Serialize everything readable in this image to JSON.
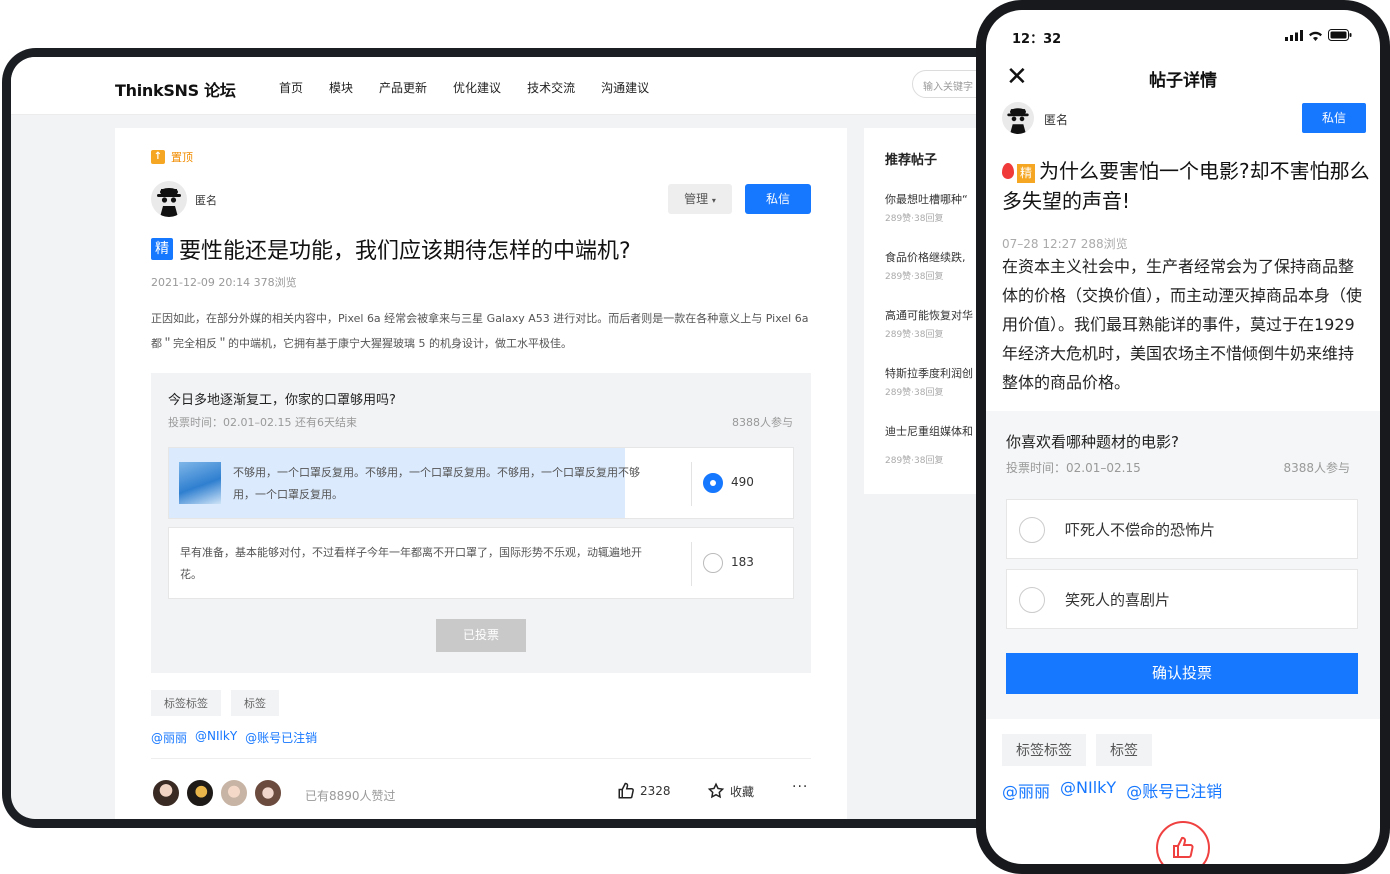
{
  "desktop": {
    "logo": {
      "brand": "ThinkSNS",
      "suffix": "论坛"
    },
    "nav": [
      "首页",
      "模块",
      "产品更新",
      "优化建议",
      "技术交流",
      "沟通建议"
    ],
    "search_placeholder": "输入关键字",
    "post": {
      "pinned_label": "置顶",
      "author": "匿名",
      "manage_label": "管理",
      "pm_label": "私信",
      "badge": "精",
      "title": "要性能还是功能，我们应该期待怎样的中端机?",
      "meta": "2021-12-09 20:14  378浏览",
      "body": "正因如此，在部分外媒的相关内容中，Pixel 6a 经常会被拿来与三星 Galaxy A53 进行对比。而后者则是一款在各种意义上与 Pixel 6a 都＂完全相反＂的中端机，它拥有基于康宁大猩猩玻璃 5 的机身设计，做工水平极佳。",
      "vote": {
        "question": "今日多地逐渐复工，你家的口罩够用吗?",
        "time": "投票时间：02.01–02.15    还有6天结束",
        "participants": "8388人参与",
        "options": [
          {
            "text": "不够用，一个口罩反复用。不够用，一个口罩反复用。不够用，一个口罩反复用不够用，一个口罩反复用。",
            "count": "490",
            "selected": true,
            "share": 0.73
          },
          {
            "text": "早有准备，基本能够对付，不过看样子今年一年都离不开口罩了，国际形势不乐观，动辄遍地开花。",
            "count": "183",
            "selected": false,
            "share": 0
          }
        ],
        "voted_label": "已投票"
      },
      "tags": [
        "标签标签",
        "标签"
      ],
      "mentions": [
        "@丽丽",
        "@NIlkY",
        "@账号已注销"
      ],
      "likers_text": "已有8890人赞过",
      "like_count": "2328",
      "fav_label": "收藏",
      "more_label": "···"
    },
    "recommend": {
      "title": "推荐帖子",
      "items": [
        {
          "title": "你最想吐槽哪种“",
          "meta": "289赞·38回复"
        },
        {
          "title": "食品价格继续跌,",
          "meta": "289赞·38回复"
        },
        {
          "title": "高通可能恢复对华",
          "meta": "289赞·38回复"
        },
        {
          "title": "特斯拉季度利润创",
          "meta": "289赞·38回复"
        },
        {
          "title": "迪士尼重组媒体和",
          "meta": "289赞·38回复"
        }
      ]
    }
  },
  "phone": {
    "status_time": "12：32",
    "header_title": "帖子详情",
    "author": "匿名",
    "pm_label": "私信",
    "badge": "精",
    "title": "为什么要害怕一个电影?却不害怕那么多失望的声音!",
    "meta": "07–28 12:27  288浏览",
    "body": "在资本主义社会中，生产者经常会为了保持商品整体的价格（交换价值），而主动湮灭掉商品本身（使用价值）。我们最耳熟能详的事件，莫过于在1929年经济大危机时，美国农场主不惜倾倒牛奶来维持整体的商品价格。",
    "vote": {
      "question": "你喜欢看哪种题材的电影?",
      "time": "投票时间：02.01–02.15",
      "participants": "8388人参与",
      "options": [
        "吓死人不偿命的恐怖片",
        "笑死人的喜剧片"
      ],
      "confirm_label": "确认投票"
    },
    "tags": [
      "标签标签",
      "标签"
    ],
    "mentions": [
      "@丽丽",
      "@NIlkY",
      "@账号已注销"
    ]
  },
  "colors": {
    "accent": "#1677ff",
    "pin": "#f5a623",
    "like": "#f04141"
  }
}
